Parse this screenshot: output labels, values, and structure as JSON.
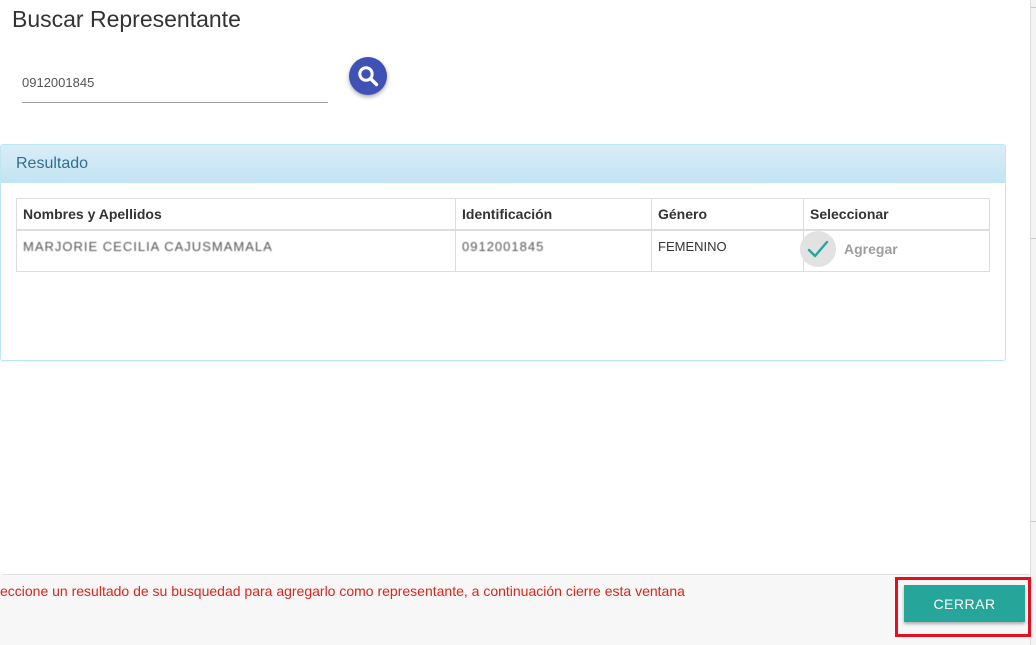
{
  "modal": {
    "title": "Buscar Representante",
    "search": {
      "value": "0912001845"
    }
  },
  "panel": {
    "heading": "Resultado",
    "columns": [
      "Nombres y Apellidos",
      "Identificación",
      "Género",
      "Seleccionar"
    ],
    "rows": [
      {
        "name": "MARJORIE CECILIA CAJUSMAMALA",
        "id": "0912001845",
        "gender": "FEMENINO",
        "action": "Agregar"
      }
    ]
  },
  "footer": {
    "message": "eccione un resultado de su busquedad para agregarlo como representante, a continuación cierre esta ventana",
    "close_label": "CERRAR"
  },
  "colors": {
    "primary_fab": "#3f51b5",
    "close_button": "#26a69a",
    "message_red": "#d9261c",
    "highlight_border": "#e3101e",
    "panel_heading_text": "#31708f"
  },
  "icons": {
    "search": "search-icon",
    "check": "check-icon"
  }
}
